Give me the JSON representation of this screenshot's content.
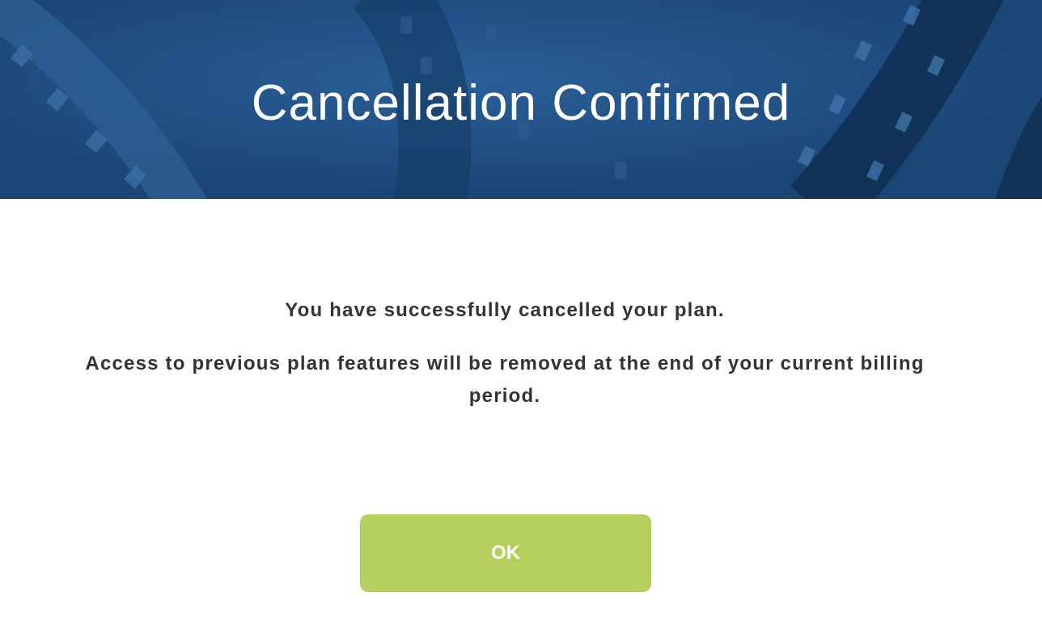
{
  "header": {
    "title": "Cancellation Confirmed",
    "background_color": "#1f4f82",
    "background_icon": "film-reel-banner"
  },
  "main": {
    "message": "You have successfully cancelled your plan.",
    "detail": "Access to previous plan features will be removed at the end of your current billing period."
  },
  "actions": {
    "ok_label": "OK",
    "ok_color": "#b5cf5c"
  }
}
